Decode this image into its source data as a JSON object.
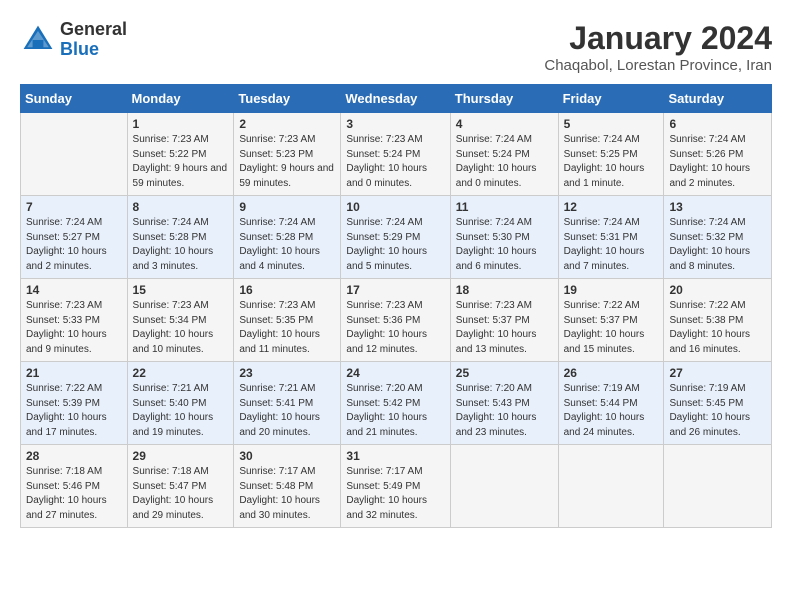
{
  "header": {
    "logo_general": "General",
    "logo_blue": "Blue",
    "month_title": "January 2024",
    "subtitle": "Chaqabol, Lorestan Province, Iran"
  },
  "days_of_week": [
    "Sunday",
    "Monday",
    "Tuesday",
    "Wednesday",
    "Thursday",
    "Friday",
    "Saturday"
  ],
  "weeks": [
    [
      {
        "day": "",
        "info": ""
      },
      {
        "day": "1",
        "info": "Sunrise: 7:23 AM\nSunset: 5:22 PM\nDaylight: 9 hours and 59 minutes."
      },
      {
        "day": "2",
        "info": "Sunrise: 7:23 AM\nSunset: 5:23 PM\nDaylight: 9 hours and 59 minutes."
      },
      {
        "day": "3",
        "info": "Sunrise: 7:23 AM\nSunset: 5:24 PM\nDaylight: 10 hours and 0 minutes."
      },
      {
        "day": "4",
        "info": "Sunrise: 7:24 AM\nSunset: 5:24 PM\nDaylight: 10 hours and 0 minutes."
      },
      {
        "day": "5",
        "info": "Sunrise: 7:24 AM\nSunset: 5:25 PM\nDaylight: 10 hours and 1 minute."
      },
      {
        "day": "6",
        "info": "Sunrise: 7:24 AM\nSunset: 5:26 PM\nDaylight: 10 hours and 2 minutes."
      }
    ],
    [
      {
        "day": "7",
        "info": "Sunrise: 7:24 AM\nSunset: 5:27 PM\nDaylight: 10 hours and 2 minutes."
      },
      {
        "day": "8",
        "info": "Sunrise: 7:24 AM\nSunset: 5:28 PM\nDaylight: 10 hours and 3 minutes."
      },
      {
        "day": "9",
        "info": "Sunrise: 7:24 AM\nSunset: 5:28 PM\nDaylight: 10 hours and 4 minutes."
      },
      {
        "day": "10",
        "info": "Sunrise: 7:24 AM\nSunset: 5:29 PM\nDaylight: 10 hours and 5 minutes."
      },
      {
        "day": "11",
        "info": "Sunrise: 7:24 AM\nSunset: 5:30 PM\nDaylight: 10 hours and 6 minutes."
      },
      {
        "day": "12",
        "info": "Sunrise: 7:24 AM\nSunset: 5:31 PM\nDaylight: 10 hours and 7 minutes."
      },
      {
        "day": "13",
        "info": "Sunrise: 7:24 AM\nSunset: 5:32 PM\nDaylight: 10 hours and 8 minutes."
      }
    ],
    [
      {
        "day": "14",
        "info": "Sunrise: 7:23 AM\nSunset: 5:33 PM\nDaylight: 10 hours and 9 minutes."
      },
      {
        "day": "15",
        "info": "Sunrise: 7:23 AM\nSunset: 5:34 PM\nDaylight: 10 hours and 10 minutes."
      },
      {
        "day": "16",
        "info": "Sunrise: 7:23 AM\nSunset: 5:35 PM\nDaylight: 10 hours and 11 minutes."
      },
      {
        "day": "17",
        "info": "Sunrise: 7:23 AM\nSunset: 5:36 PM\nDaylight: 10 hours and 12 minutes."
      },
      {
        "day": "18",
        "info": "Sunrise: 7:23 AM\nSunset: 5:37 PM\nDaylight: 10 hours and 13 minutes."
      },
      {
        "day": "19",
        "info": "Sunrise: 7:22 AM\nSunset: 5:37 PM\nDaylight: 10 hours and 15 minutes."
      },
      {
        "day": "20",
        "info": "Sunrise: 7:22 AM\nSunset: 5:38 PM\nDaylight: 10 hours and 16 minutes."
      }
    ],
    [
      {
        "day": "21",
        "info": "Sunrise: 7:22 AM\nSunset: 5:39 PM\nDaylight: 10 hours and 17 minutes."
      },
      {
        "day": "22",
        "info": "Sunrise: 7:21 AM\nSunset: 5:40 PM\nDaylight: 10 hours and 19 minutes."
      },
      {
        "day": "23",
        "info": "Sunrise: 7:21 AM\nSunset: 5:41 PM\nDaylight: 10 hours and 20 minutes."
      },
      {
        "day": "24",
        "info": "Sunrise: 7:20 AM\nSunset: 5:42 PM\nDaylight: 10 hours and 21 minutes."
      },
      {
        "day": "25",
        "info": "Sunrise: 7:20 AM\nSunset: 5:43 PM\nDaylight: 10 hours and 23 minutes."
      },
      {
        "day": "26",
        "info": "Sunrise: 7:19 AM\nSunset: 5:44 PM\nDaylight: 10 hours and 24 minutes."
      },
      {
        "day": "27",
        "info": "Sunrise: 7:19 AM\nSunset: 5:45 PM\nDaylight: 10 hours and 26 minutes."
      }
    ],
    [
      {
        "day": "28",
        "info": "Sunrise: 7:18 AM\nSunset: 5:46 PM\nDaylight: 10 hours and 27 minutes."
      },
      {
        "day": "29",
        "info": "Sunrise: 7:18 AM\nSunset: 5:47 PM\nDaylight: 10 hours and 29 minutes."
      },
      {
        "day": "30",
        "info": "Sunrise: 7:17 AM\nSunset: 5:48 PM\nDaylight: 10 hours and 30 minutes."
      },
      {
        "day": "31",
        "info": "Sunrise: 7:17 AM\nSunset: 5:49 PM\nDaylight: 10 hours and 32 minutes."
      },
      {
        "day": "",
        "info": ""
      },
      {
        "day": "",
        "info": ""
      },
      {
        "day": "",
        "info": ""
      }
    ]
  ]
}
